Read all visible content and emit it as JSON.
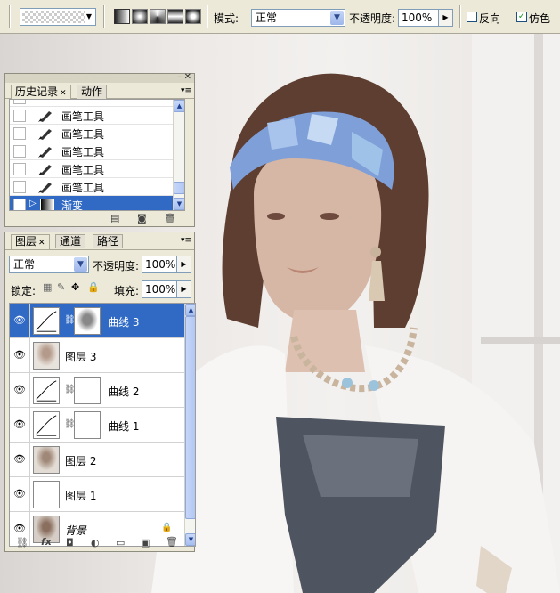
{
  "options_bar": {
    "mode_label": "模式:",
    "mode_value": "正常",
    "opacity_label": "不透明度:",
    "opacity_value": "100%",
    "reverse_label": "反向",
    "reverse_checked": false,
    "dither_label": "仿色",
    "dither_checked": true,
    "gradient_types": [
      "linear-gradient-icon",
      "radial-gradient-icon",
      "angle-gradient-icon",
      "reflected-gradient-icon",
      "diamond-gradient-icon"
    ]
  },
  "history_panel": {
    "tabs": [
      {
        "label": "历史记录",
        "active": true
      },
      {
        "label": "动作",
        "active": false
      }
    ],
    "items": [
      {
        "label": "画笔工具",
        "icon": "brush-icon",
        "selected": false
      },
      {
        "label": "画笔工具",
        "icon": "brush-icon",
        "selected": false
      },
      {
        "label": "画笔工具",
        "icon": "brush-icon",
        "selected": false
      },
      {
        "label": "画笔工具",
        "icon": "brush-icon",
        "selected": false
      },
      {
        "label": "画笔工具",
        "icon": "brush-icon",
        "selected": false
      },
      {
        "label": "渐变",
        "icon": "gradient-icon",
        "selected": true
      }
    ]
  },
  "layers_panel": {
    "tabs": [
      {
        "label": "图层",
        "active": true
      },
      {
        "label": "通道",
        "active": false
      },
      {
        "label": "路径",
        "active": false
      }
    ],
    "blend_mode": "正常",
    "opacity_label": "不透明度:",
    "opacity_value": "100%",
    "lock_label": "锁定:",
    "fill_label": "填充:",
    "fill_value": "100%",
    "layers": [
      {
        "name": "曲线 3",
        "type": "curves",
        "mask": "dark",
        "selected": true,
        "visible": true
      },
      {
        "name": "图层 3",
        "type": "photo",
        "selected": false,
        "visible": true
      },
      {
        "name": "曲线 2",
        "type": "curves",
        "mask": "white",
        "selected": false,
        "visible": true
      },
      {
        "name": "曲线 1",
        "type": "curves",
        "mask": "white",
        "selected": false,
        "visible": true
      },
      {
        "name": "图层 2",
        "type": "photo",
        "selected": false,
        "visible": true
      },
      {
        "name": "图层 1",
        "type": "blank",
        "selected": false,
        "visible": true
      },
      {
        "name": "背景",
        "type": "photo",
        "selected": false,
        "visible": true,
        "locked": true
      }
    ]
  },
  "colors": {
    "selection": "#316ac5",
    "panel_bg": "#ece9d8",
    "headband": "#7f9fd8",
    "hair": "#5e3e30"
  }
}
